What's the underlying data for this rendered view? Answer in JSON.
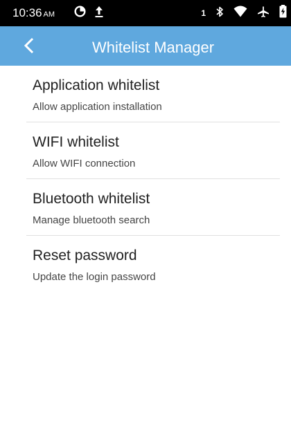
{
  "status_bar": {
    "time": "10:36",
    "ampm": "AM",
    "sim_number": "1",
    "icons": [
      "data-saver-icon",
      "upload-icon",
      "bluetooth-icon",
      "wifi-icon",
      "airplane-icon",
      "battery-charging-icon"
    ]
  },
  "header": {
    "title": "Whitelist Manager",
    "back_icon": "back-arrow-icon",
    "color": "#5fa8de"
  },
  "menu": {
    "items": [
      {
        "title": "Application whitelist",
        "subtitle": "Allow application installation"
      },
      {
        "title": "WIFI whitelist",
        "subtitle": "Allow WIFI connection"
      },
      {
        "title": "Bluetooth whitelist",
        "subtitle": "Manage bluetooth search"
      },
      {
        "title": "Reset password",
        "subtitle": "Update the login password"
      }
    ]
  }
}
